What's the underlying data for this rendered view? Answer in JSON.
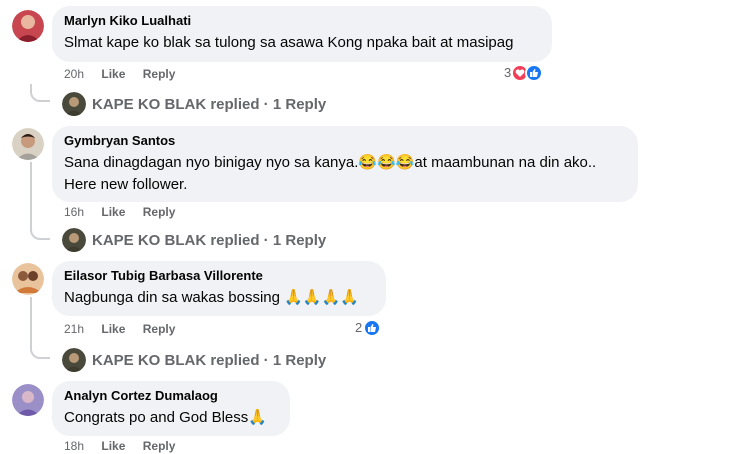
{
  "comments": [
    {
      "name": "Marlyn Kiko Lualhati",
      "text": "Slmat kape ko blak sa tulong sa asawa Kong npaka bait at masipag",
      "time": "20h",
      "like": "Like",
      "reply": "Reply",
      "reaction_count": "3",
      "replied_label": "KAPE KO BLAK replied · 1 Reply"
    },
    {
      "name": "Gymbryan Santos",
      "text_line1": "Sana dinagdagan nyo binigay nyo sa kanya.",
      "emoji1": "😂😂😂",
      "text_line1b": "at maambunan na din ako..",
      "text_line2": "Here new follower.",
      "time": "16h",
      "like": "Like",
      "reply": "Reply",
      "replied_label": "KAPE KO BLAK replied · 1 Reply"
    },
    {
      "name": "Eilasor Tubig Barbasa Villorente",
      "text": "Nagbunga din sa wakas bossing",
      "emoji": "🙏🙏🙏🙏",
      "time": "21h",
      "like": "Like",
      "reply": "Reply",
      "reaction_count": "2",
      "replied_label": "KAPE KO BLAK replied · 1 Reply"
    },
    {
      "name": "Analyn Cortez Dumalaog",
      "text": "Congrats po and God Bless",
      "emoji": "🙏",
      "time": "18h",
      "like": "Like",
      "reply": "Reply"
    }
  ],
  "colors": {
    "bubble": "#f0f2f5",
    "meta": "#65676b",
    "heart": "#f33e58",
    "like": "#1877f2"
  }
}
